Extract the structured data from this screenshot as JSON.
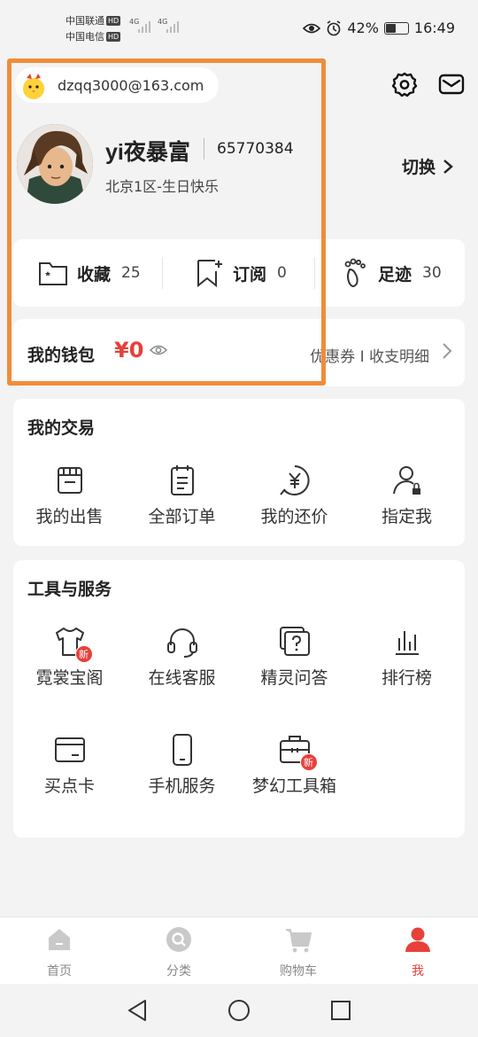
{
  "status_bar": {
    "carrier1": "中国联通",
    "carrier2": "中国电信",
    "hd": "HD",
    "net1": "4G",
    "net2": "4G",
    "battery": "42%",
    "time": "16:49"
  },
  "account": {
    "email": "dzqq3000@163.com"
  },
  "profile": {
    "username": "yi夜暴富",
    "user_id": "65770384",
    "server": "北京1区-生日快乐",
    "switch_label": "切换"
  },
  "stats": {
    "favorites_label": "收藏",
    "favorites_count": "25",
    "subscribe_label": "订阅",
    "subscribe_count": "0",
    "footprint_label": "足迹",
    "footprint_count": "30"
  },
  "wallet": {
    "title": "我的钱包",
    "amount": "¥0",
    "links": "优惠券 I 收支明细"
  },
  "trade": {
    "title": "我的交易",
    "items": [
      {
        "label": "我的出售",
        "icon": "shop-icon"
      },
      {
        "label": "全部订单",
        "icon": "order-list-icon"
      },
      {
        "label": "我的还价",
        "icon": "yen-icon"
      },
      {
        "label": "指定我",
        "icon": "user-lock-icon"
      }
    ]
  },
  "tools": {
    "title": "工具与服务",
    "new_badge": "新",
    "items": [
      {
        "label": "霓裳宝阁",
        "icon": "tshirt-icon"
      },
      {
        "label": "在线客服",
        "icon": "headset-icon"
      },
      {
        "label": "精灵问答",
        "icon": "question-icon"
      },
      {
        "label": "排行榜",
        "icon": "ranking-icon"
      },
      {
        "label": "买点卡",
        "icon": "card-icon"
      },
      {
        "label": "手机服务",
        "icon": "phone-icon"
      },
      {
        "label": "梦幻工具箱",
        "icon": "toolbox-icon"
      }
    ]
  },
  "tabbar": {
    "tabs": [
      {
        "label": "首页",
        "icon": "home-icon"
      },
      {
        "label": "分类",
        "icon": "search-icon"
      },
      {
        "label": "购物车",
        "icon": "cart-icon"
      },
      {
        "label": "我",
        "icon": "user-icon"
      }
    ],
    "active_color": "#e8403a"
  },
  "colors": {
    "accent": "#e8403a",
    "highlight": "#f08c3a"
  }
}
